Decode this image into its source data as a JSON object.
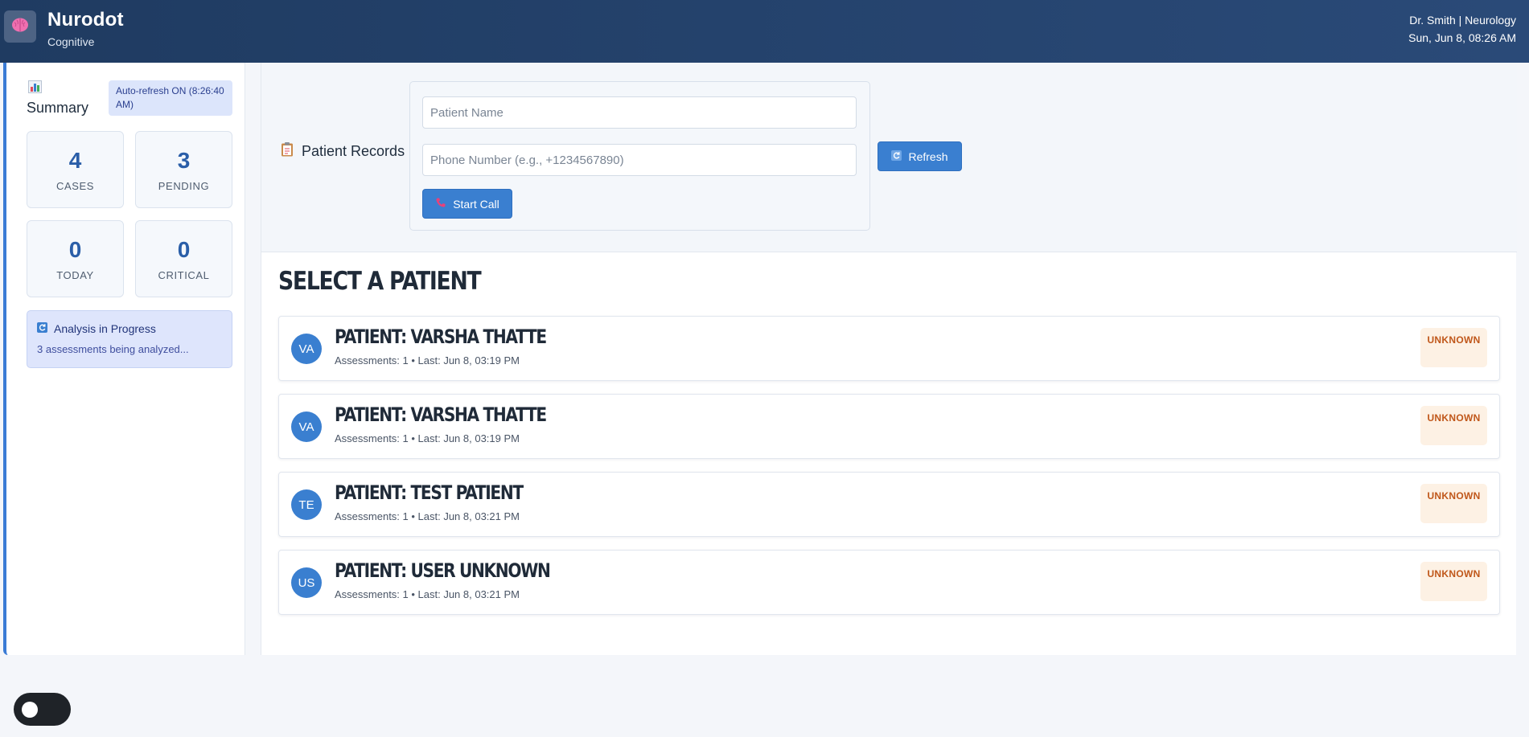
{
  "header": {
    "app_name": "Nurodot",
    "app_subtitle": "Cognitive",
    "user": "Dr. Smith | Neurology",
    "datetime": "Sun, Jun 8, 08:26 AM",
    "logo_icon": "brain-icon"
  },
  "sidebar": {
    "summary_title": "Summary",
    "summary_icon": "bar-chart-icon",
    "auto_refresh": "Auto-refresh ON (8:26:40 AM)",
    "stats": [
      {
        "value": "4",
        "label": "CASES"
      },
      {
        "value": "3",
        "label": "PENDING"
      },
      {
        "value": "0",
        "label": "TODAY"
      },
      {
        "value": "0",
        "label": "CRITICAL"
      }
    ],
    "analysis": {
      "title": "Analysis in Progress",
      "description": "3 assessments being analyzed...",
      "icon": "refresh-icon"
    }
  },
  "records": {
    "title": "Patient Records",
    "icon": "clipboard-icon",
    "name_placeholder": "Patient Name",
    "phone_placeholder": "Phone Number (e.g., +1234567890)",
    "start_call_label": "Start Call",
    "refresh_label": "Refresh"
  },
  "patients_section": {
    "title": "SELECT A PATIENT",
    "patients": [
      {
        "initials": "VA",
        "name": "PATIENT: VARSHA THATTE",
        "meta": "Assessments: 1 • Last: Jun 8, 03:19 PM",
        "status": "UNKNOWN"
      },
      {
        "initials": "VA",
        "name": "PATIENT: VARSHA THATTE",
        "meta": "Assessments: 1 • Last: Jun 8, 03:19 PM",
        "status": "UNKNOWN"
      },
      {
        "initials": "TE",
        "name": "PATIENT: TEST PATIENT",
        "meta": "Assessments: 1 • Last: Jun 8, 03:21 PM",
        "status": "UNKNOWN"
      },
      {
        "initials": "US",
        "name": "PATIENT: USER UNKNOWN",
        "meta": "Assessments: 1 • Last: Jun 8, 03:21 PM",
        "status": "UNKNOWN"
      }
    ]
  },
  "colors": {
    "header_bg": "#1f3b61",
    "accent": "#3a7fd0",
    "status_unknown_text": "#c0571a",
    "status_unknown_bg": "#fdf1e4"
  }
}
